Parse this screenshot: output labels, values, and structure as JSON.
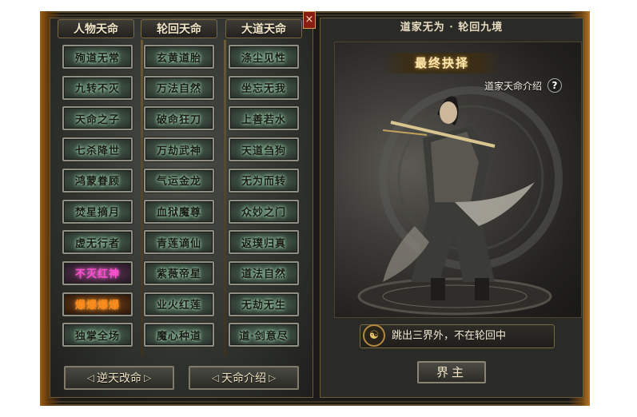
{
  "window": {
    "close_label": "×"
  },
  "columns": [
    {
      "header": "人物天命",
      "items": [
        "殉道无常",
        "九转不灭",
        "天命之子",
        "七杀降世",
        "鸿蒙眷顾",
        "焚星摘月",
        "虚无行者",
        "不灭红神",
        "爆爆爆爆",
        "独掌全场"
      ]
    },
    {
      "header": "轮回天命",
      "items": [
        "玄黄道胎",
        "万法自然",
        "破命狂刀",
        "万劫武神",
        "气运金龙",
        "血狱魔尊",
        "青莲谪仙",
        "紫薇帝星",
        "业火红莲",
        "魔心种道"
      ]
    },
    {
      "header": "大道天命",
      "items": [
        "涤尘见性",
        "坐忘无我",
        "上善若水",
        "天道刍狗",
        "无为而转",
        "众妙之门",
        "返璞归真",
        "道法自然",
        "无劫无生",
        "道·剑意尽"
      ]
    }
  ],
  "special_slots": {
    "pink": "不灭红神",
    "fire": "爆爆爆爆"
  },
  "buttons": {
    "reverse_fate": "逆天改命",
    "fate_intro": "天命介绍",
    "confirm": "界主",
    "arrow_left": "◁",
    "arrow_right": "▷"
  },
  "right_panel": {
    "title": "道家无为 · 轮回九境",
    "banner": "最终抉择",
    "intro_label": "道家天命介绍",
    "help_icon": "?",
    "quote": "跳出三界外，不在轮回中",
    "quote_icon": "☯"
  },
  "colors": {
    "accent_gold": "#d7a34a",
    "slot_glow": "#a9d6b7",
    "pink": "#ff4fd0",
    "fire": "#ff8a1a"
  }
}
